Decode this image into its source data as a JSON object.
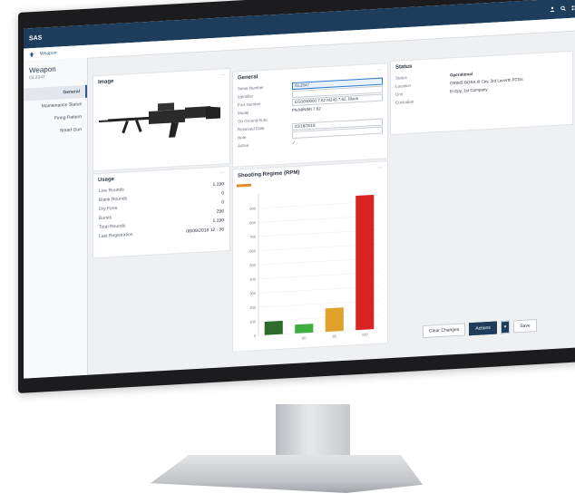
{
  "app": {
    "title": "SAS",
    "nav_icons": [
      "user-icon",
      "search-icon",
      "grid-icon",
      "more-icon"
    ]
  },
  "breadcrumb": {
    "label": "Weapon"
  },
  "left_nav": {
    "title": "Weapon",
    "subtitle": "GL2047",
    "items": [
      {
        "label": "General",
        "active": true
      },
      {
        "label": "Maintenance Status",
        "active": false
      },
      {
        "label": "Firing Pattern",
        "active": false
      },
      {
        "label": "Smart Gun",
        "active": false
      }
    ]
  },
  "image_card": {
    "title": "Image"
  },
  "usage_card": {
    "title": "Usage",
    "rows": [
      {
        "label": "Live Rounds",
        "value": "1,190"
      },
      {
        "label": "Blank Rounds",
        "value": "0"
      },
      {
        "label": "Dry Fires",
        "value": "0"
      },
      {
        "label": "Bursts",
        "value": "296"
      },
      {
        "label": "Total Rounds",
        "value": "1,190"
      },
      {
        "label": "Last Registration",
        "value": "08/09/2018 12 : 36"
      }
    ]
  },
  "general_card": {
    "title": "General",
    "rows": [
      {
        "label": "Serial Number",
        "value": "GL2047",
        "kind": "input-focus"
      },
      {
        "label": "Identifier",
        "value": "",
        "kind": "input"
      },
      {
        "label": "Part Number",
        "value": "EG0000000 7.62 M240 7.62, Black",
        "kind": "input"
      },
      {
        "label": "Model",
        "value": "FN MINIMI 7.62",
        "kind": "text"
      },
      {
        "label": "On Ground Auto",
        "value": "",
        "kind": "text"
      },
      {
        "label": "Received Date",
        "value": "03/18/2018",
        "kind": "input"
      },
      {
        "label": "Note",
        "value": "",
        "kind": "input"
      },
      {
        "label": "Active",
        "value": "✓",
        "kind": "text"
      }
    ]
  },
  "status_card": {
    "title": "Status",
    "rows": [
      {
        "label": "Status",
        "value": "Operational"
      },
      {
        "label": "Location",
        "value": "GRIMS BOSA III Cpy, 3rd Lavorth FCGs"
      },
      {
        "label": "Unit",
        "value": "III Cpy, 1st Company"
      },
      {
        "label": "Custodian",
        "value": ""
      }
    ]
  },
  "chart_data": {
    "type": "bar",
    "title": "Shooting Regime (RPM)",
    "categories": [
      "",
      "",
      "",
      ""
    ],
    "values": [
      95,
      62,
      165,
      950
    ],
    "colors": [
      "#2f6b2a",
      "#3fae3d",
      "#e0a12a",
      "#d92424"
    ],
    "ylim": [
      0,
      1000
    ],
    "yticks": [
      0,
      100,
      200,
      300,
      400,
      500,
      600,
      700,
      800,
      900
    ],
    "xtick_labels": [
      "",
      "60",
      "80",
      "100"
    ],
    "accent": "#e08a1e"
  },
  "actions": {
    "clear_changes": "Clear Changes",
    "actions": "Actions",
    "save": "Save"
  }
}
